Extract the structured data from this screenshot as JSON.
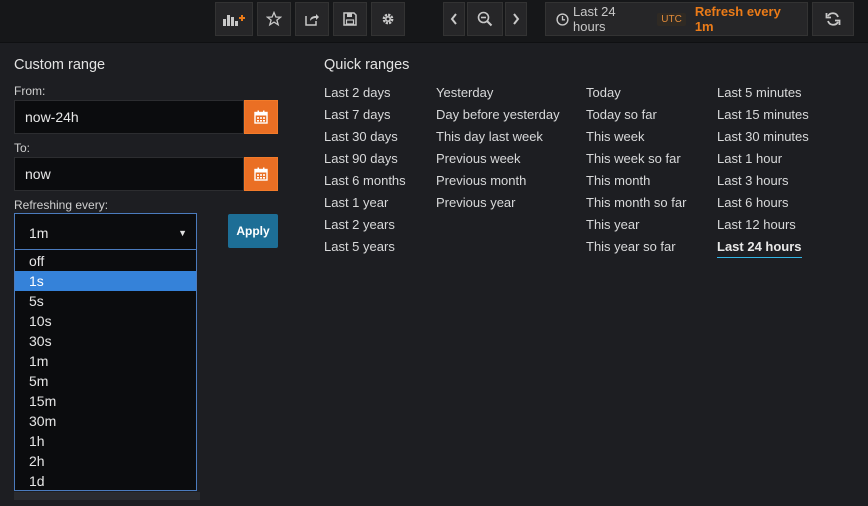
{
  "toolbar": {
    "icons": [
      "add-panel-icon",
      "star-icon",
      "share-icon",
      "save-icon",
      "settings-icon"
    ],
    "time_nav": [
      "chevron-left-icon",
      "zoom-out-icon",
      "chevron-right-icon"
    ],
    "time_range_label": "Last 24 hours",
    "timezone": "UTC",
    "refresh_label": "Refresh every 1m",
    "accent_color": "#eb7b18"
  },
  "custom_range": {
    "title": "Custom range",
    "from_label": "From:",
    "from_value": "now-24h",
    "to_label": "To:",
    "to_value": "now",
    "refresh_label": "Refreshing every:",
    "refresh_value": "1m",
    "apply_label": "Apply",
    "refresh_options": [
      "off",
      "1s",
      "5s",
      "10s",
      "30s",
      "1m",
      "5m",
      "15m",
      "30m",
      "1h",
      "2h",
      "1d"
    ],
    "highlighted_option": "1s"
  },
  "quick_ranges": {
    "title": "Quick ranges",
    "columns": [
      [
        "Last 2 days",
        "Last 7 days",
        "Last 30 days",
        "Last 90 days",
        "Last 6 months",
        "Last 1 year",
        "Last 2 years",
        "Last 5 years"
      ],
      [
        "Yesterday",
        "Day before yesterday",
        "This day last week",
        "Previous week",
        "Previous month",
        "Previous year"
      ],
      [
        "Today",
        "Today so far",
        "This week",
        "This week so far",
        "This month",
        "This month so far",
        "This year",
        "This year so far"
      ],
      [
        "Last 5 minutes",
        "Last 15 minutes",
        "Last 30 minutes",
        "Last 1 hour",
        "Last 3 hours",
        "Last 6 hours",
        "Last 12 hours",
        "Last 24 hours"
      ]
    ],
    "active": "Last 24 hours"
  }
}
